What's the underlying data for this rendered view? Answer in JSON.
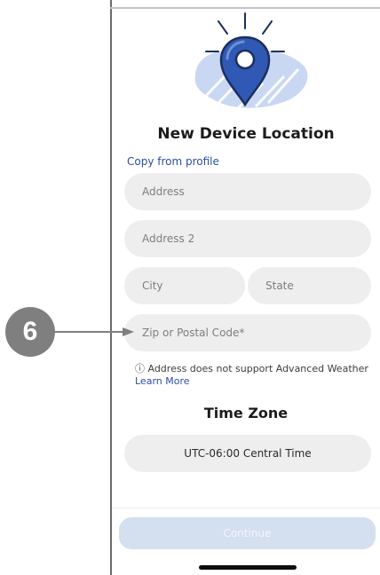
{
  "header": {
    "title": "New Device Location",
    "copy_from_profile": "Copy from profile"
  },
  "form": {
    "address_placeholder": "Address",
    "address2_placeholder": "Address 2",
    "city_placeholder": "City",
    "state_placeholder": "State",
    "zip_placeholder": "Zip or Postal Code*"
  },
  "notice": {
    "text": "ⓘ Address does not support Advanced Weather",
    "learn_more": "Learn More"
  },
  "time_zone": {
    "title": "Time Zone",
    "value": "UTC-06:00 Central Time"
  },
  "footer": {
    "continue_label": "Continue"
  },
  "callout": {
    "number": "6"
  },
  "colors": {
    "accent": "#2a4fa8",
    "pin": "#2f59b4",
    "field_bg": "#eeeeee",
    "disabled_button": "#d4dff0"
  }
}
